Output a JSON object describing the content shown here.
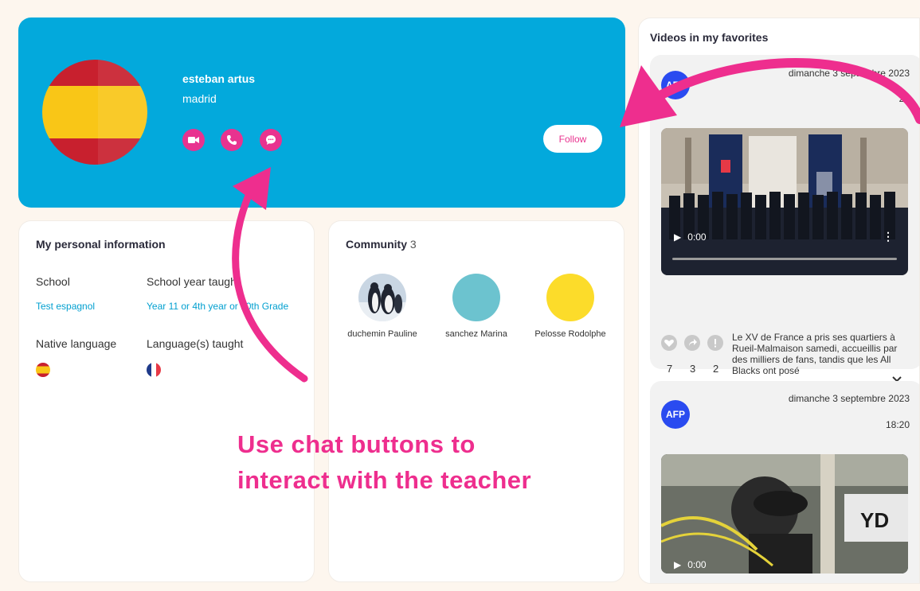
{
  "profile": {
    "name": "esteban artus",
    "city": "madrid",
    "follow_label": "Follow",
    "actions": [
      "video-call",
      "phone-call",
      "chat"
    ]
  },
  "personal_info": {
    "title": "My personal information",
    "school_label": "School",
    "school_value": "Test espagnol",
    "year_label": "School year taught",
    "year_value": "Year 11 or 4th year or 10th Grade",
    "native_label": "Native language",
    "native_flag": "spain-flag",
    "taught_label": "Language(s) taught",
    "taught_flag": "france-flag"
  },
  "community": {
    "title": "Community",
    "count": "3",
    "members": [
      {
        "name": "duchemin Pauline",
        "avatar": "penguins-photo"
      },
      {
        "name": "sanchez Marina",
        "avatar_color": "#6cc3cf"
      },
      {
        "name": "Pelosse Rodolphe",
        "avatar_color": "#fcdc2a"
      }
    ]
  },
  "favorites": {
    "title": "Videos in my favorites",
    "videos": [
      {
        "source": "AFP",
        "date": "dimanche 3 septembre 2023",
        "time_partial": "26",
        "player_time": "0:00",
        "reactions": {
          "likes": "7",
          "shares": "3",
          "alerts": "2"
        },
        "description": "Le XV de France a pris ses quartiers à Rueil-Malmaison samedi, accueillis par des milliers de fans, tandis que les All Blacks ont posé"
      },
      {
        "source": "AFP",
        "date": "dimanche 3 septembre 2023",
        "time": "18:20",
        "player_time": "0:00"
      }
    ]
  },
  "annotation": {
    "line1": "Use chat buttons to",
    "line2": "interact with the teacher"
  },
  "colors": {
    "hero": "#03a9dc",
    "accent": "#e8338f",
    "annotation": "#ee2e8e",
    "page_bg": "#fdf6ee"
  }
}
